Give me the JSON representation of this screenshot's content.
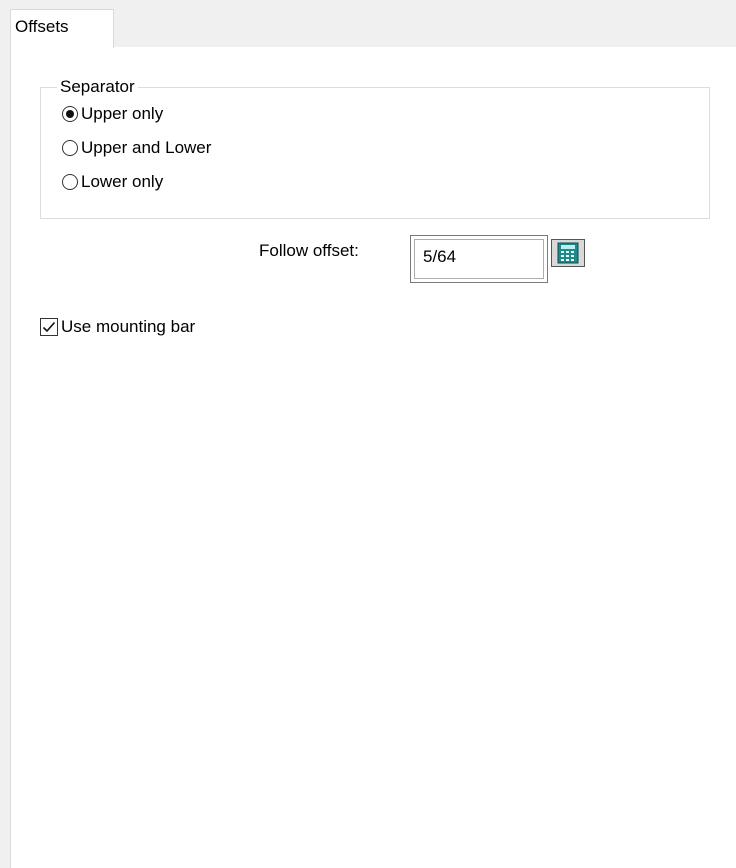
{
  "tabs": [
    {
      "label": "Offsets",
      "selected": true
    }
  ],
  "separator": {
    "title": "Separator",
    "options": [
      {
        "label": "Upper only",
        "checked": true
      },
      {
        "label": "Upper and Lower",
        "checked": false
      },
      {
        "label": "Lower only",
        "checked": false
      }
    ]
  },
  "follow_offset": {
    "label": "Follow offset:",
    "value": "5/64",
    "button_icon": "calculator-icon"
  },
  "mounting_bar": {
    "label": "Use mounting bar",
    "checked": true
  },
  "colors": {
    "calculator_accent": "#1e8a8a",
    "panel_background": "#ffffff",
    "window_background": "#f0f0f0"
  }
}
